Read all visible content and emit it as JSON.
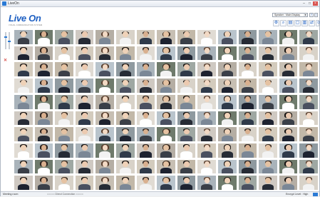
{
  "window": {
    "title": "LiveOn"
  },
  "header": {
    "logo": "Live On",
    "logo_sub": "VISUAL COMMUNICATION SYSTEM",
    "speaker_select": "Speaker : Main Display",
    "help_label": "?",
    "toolbar_icons": [
      "settings-icon",
      "search-icon",
      "document-icon",
      "window-icon",
      "chart-icon",
      "share-icon",
      "users-icon"
    ]
  },
  "grid": {
    "rows": 10,
    "cols": 15
  },
  "status": {
    "left": "Meeting room",
    "middle": "○○○○○ Direct Connection ○○○○○",
    "right": "Encrypt Level : High"
  },
  "colors": {
    "brand": "#1d5fc2",
    "close": "#d9534f"
  }
}
